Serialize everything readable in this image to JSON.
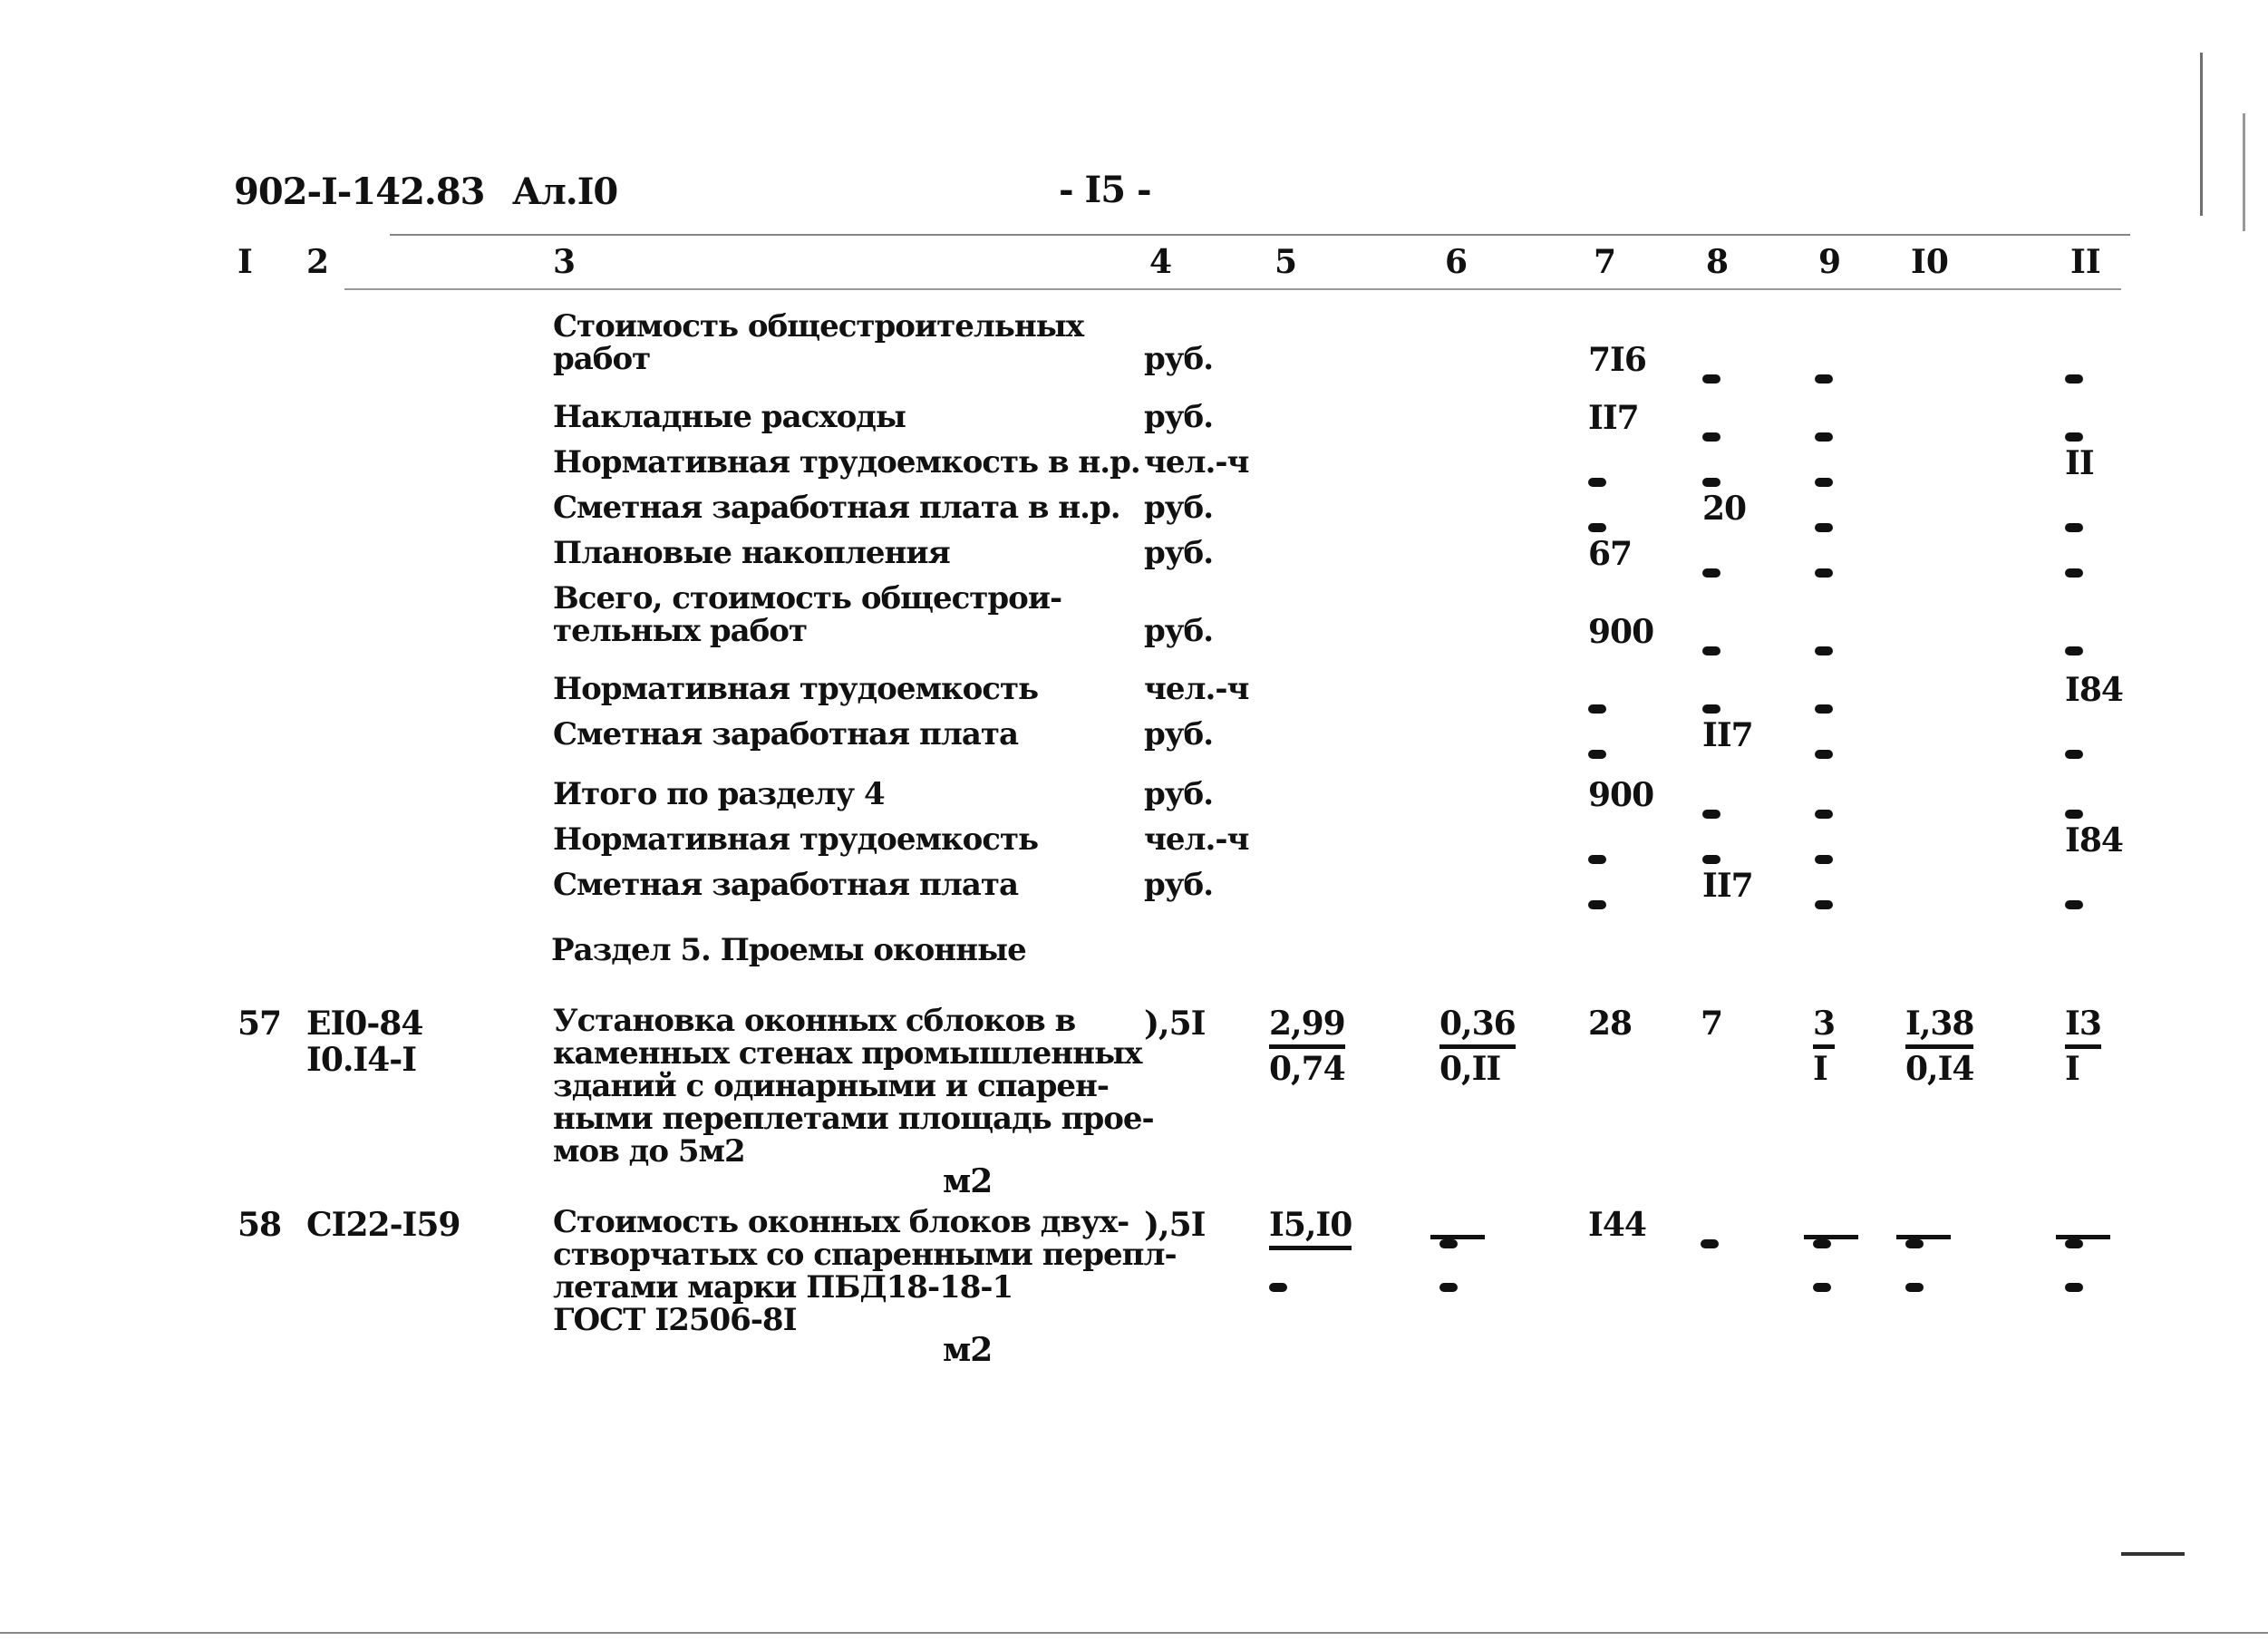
{
  "header": {
    "doc_code": "902-I-142.83",
    "album": "Ал.I0",
    "page_number": "- I5 -"
  },
  "columns": [
    "I",
    "2",
    "3",
    "4",
    "5",
    "6",
    "7",
    "8",
    "9",
    "I0",
    "II"
  ],
  "summary_rows": [
    {
      "name": "Стоимость общестроительных\nработ",
      "unit": "руб.",
      "c7": "7I6",
      "c8": "-",
      "c9": "-",
      "c11": "-"
    },
    {
      "name": "Накладные расходы",
      "unit": "руб.",
      "c7": "II7",
      "c8": "-",
      "c9": "-",
      "c11": "-"
    },
    {
      "name": "Нормативная трудоемкость в н.р.",
      "unit": "чел.-ч",
      "c7": "-",
      "c8": "-",
      "c9": "-",
      "c11": "II"
    },
    {
      "name": "Сметная заработная плата в н.р.",
      "unit": "руб.",
      "c7": "-",
      "c8": "20",
      "c9": "-",
      "c11": "-"
    },
    {
      "name": "Плановые накопления",
      "unit": "руб.",
      "c7": "67",
      "c8": "-",
      "c9": "-",
      "c11": "-"
    },
    {
      "name": "Всего, стоимость общестрои-\nтельных работ",
      "unit": "руб.",
      "c7": "900",
      "c8": "-",
      "c9": "-",
      "c11": "-"
    },
    {
      "name": "Нормативная трудоемкость",
      "unit": "чел.-ч",
      "c7": "-",
      "c8": "-",
      "c9": "-",
      "c11": "I84"
    },
    {
      "name": "Сметная заработная плата",
      "unit": "руб.",
      "c7": "-",
      "c8": "II7",
      "c9": "-",
      "c11": "-"
    },
    {
      "name": "Итого по разделу 4",
      "unit": "руб.",
      "c7": "900",
      "c8": "-",
      "c9": "-",
      "c11": "-"
    },
    {
      "name": "Нормативная трудоемкость",
      "unit": "чел.-ч",
      "c7": "-",
      "c8": "-",
      "c9": "-",
      "c11": "I84"
    },
    {
      "name": "Сметная заработная плата",
      "unit": "руб.",
      "c7": "-",
      "c8": "II7",
      "c9": "-",
      "c11": "-"
    }
  ],
  "section5": {
    "title": "Раздел 5.  Проемы оконные"
  },
  "items": [
    {
      "num": "57",
      "code_line1": "EI0-84",
      "code_line2": "I0.I4-I",
      "desc": [
        "Установка оконных сблоков в",
        "каменных стенах промышленных",
        "зданий с одинарными и спарен-",
        "ными переплетами площадь прое-",
        "мов до 5м2"
      ],
      "unit": "м2",
      "c4": "),5I",
      "c5_top": "2,99",
      "c5_bottom": "0,74",
      "c6_top": "0,36",
      "c6_bottom": "0,II",
      "c7": "28",
      "c8": "7",
      "c9_top": "3",
      "c9_bottom": "I",
      "c10_top": "I,38",
      "c10_bottom": "0,I4",
      "c11_top": "I3",
      "c11_bottom": "I"
    },
    {
      "num": "58",
      "code_line1": "CI22-I59",
      "desc": [
        "Стоимость оконных блоков двух-",
        "створчатых со спаренными перепл-",
        "летами марки ПБД18-18-1",
        "ГОСТ I2506-8I"
      ],
      "unit": "м2",
      "c4": "),5I",
      "c5_top": "I5,I0",
      "c5_bottom": "-",
      "c6_top": "-",
      "c6_bottom": "-",
      "c7": "I44",
      "c8": "-",
      "c9_top": "-",
      "c9_bottom": "-",
      "c10_top": "-",
      "c10_bottom": "-",
      "c11_top": "-",
      "c11_bottom": "-"
    }
  ]
}
